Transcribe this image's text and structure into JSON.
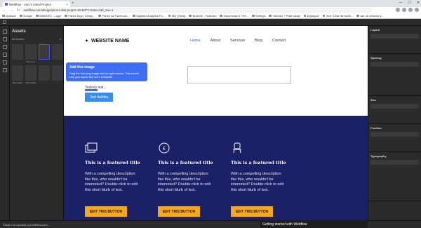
{
  "browser": {
    "tab_title": "Webflow - Jaro's Initial Project",
    "url": "webflow.com/design/jaros-initial-project-42c6d7?=54&v=0&l_nav=1",
    "bookmarks": [
      "Aplikace",
      "Google",
      "WAWKES - Login",
      "Pánek Sign | Český...",
      "Pánek na Facebook...",
      "Digitální Analytics Fo...",
      "MQ (Hlefa)",
      "Brownie - Featured",
      "Importování z Tref...",
      "Settings",
      "Yamoan + Plate udaty",
      "Digitopod",
      "Více Číhat dle bodů...",
      "Jak na reklamu a..."
    ]
  },
  "assets": {
    "title": "Assets",
    "filter": "All Assets",
    "thumbs": [
      {
        "label": ""
      },
      {
        "label": "Skin-tone"
      },
      {
        "label": ""
      },
      {
        "label": ""
      },
      {
        "label": "Skin-Cable"
      },
      {
        "label": "Skin-Cable"
      },
      {
        "label": ""
      },
      {
        "label": ""
      }
    ]
  },
  "site": {
    "logo": "WEBSITE NAME",
    "nav": [
      "Home",
      "About",
      "Services",
      "Blog",
      "Contact"
    ],
    "test_text": "Testový text...",
    "test_button": "Text tlačítka",
    "selected_badge": "Button"
  },
  "tooltip": {
    "title": "Add this image",
    "body": "Drag the hero.png image into the right column. This should help your layout feel more complete!"
  },
  "features": [
    {
      "title": "This is a featured title",
      "body": "With a compelling description like this, who wouldn't be interested? Double-click to edit this short blurb of text.",
      "button": "EDIT THIS BUTTON"
    },
    {
      "title": "This is a featured title",
      "body": "With a compelling description like this, who wouldn't be interested? Double-click to edit this short blurb of text.",
      "button": "EDIT THIS BUTTON"
    },
    {
      "title": "This is a featured title",
      "body": "With a compelling description like this, who wouldn't be interested? Double-click to edit this short blurb of text.",
      "button": "EDIT THIS BUTTON"
    }
  ],
  "right_panel": [
    "Layout",
    "Spacing",
    "Size",
    "Position",
    "Typography"
  ],
  "status": {
    "left": "Čekání na uploads-ssl.webflow.com...",
    "guide": "Getting started with Webflow"
  }
}
